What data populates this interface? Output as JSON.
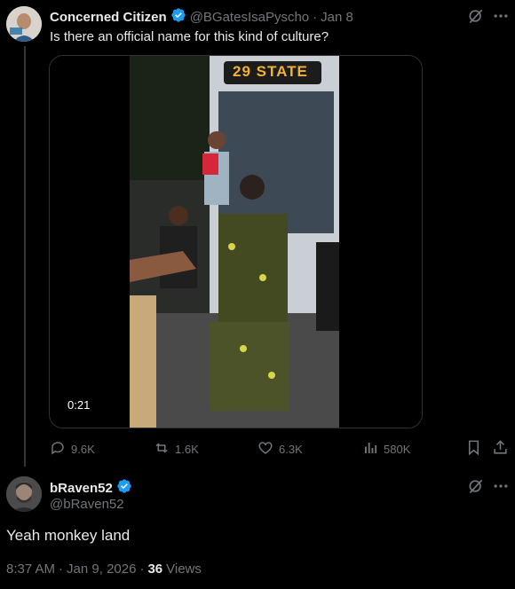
{
  "parent_post": {
    "display_name": "Concerned Citizen",
    "handle": "@BGatesIsaPyscho",
    "separator": "·",
    "date": "Jan 8",
    "text": "Is there an official name for this kind of culture?",
    "video_duration": "0:21",
    "bus_sign_text": "29 STATE",
    "stats": {
      "replies": "9.6K",
      "reposts": "1.6K",
      "likes": "6.3K",
      "views": "580K"
    }
  },
  "reply_post": {
    "display_name": "bRaven52",
    "handle": "@bRaven52",
    "text": "Yeah monkey land",
    "time": "8:37 AM",
    "date": "Jan 9, 2026",
    "separator1": "·",
    "separator2": "·",
    "views_count": "36",
    "views_label": "Views"
  },
  "colors": {
    "background": "#000000",
    "text": "#e7e9ea",
    "muted": "#71767b",
    "verified": "#1d9bf0",
    "border": "#2f3336"
  },
  "icons": [
    "grok-icon",
    "more-icon",
    "reply-icon",
    "repost-icon",
    "like-icon",
    "views-icon",
    "bookmark-icon",
    "share-icon",
    "verified-badge-icon"
  ]
}
